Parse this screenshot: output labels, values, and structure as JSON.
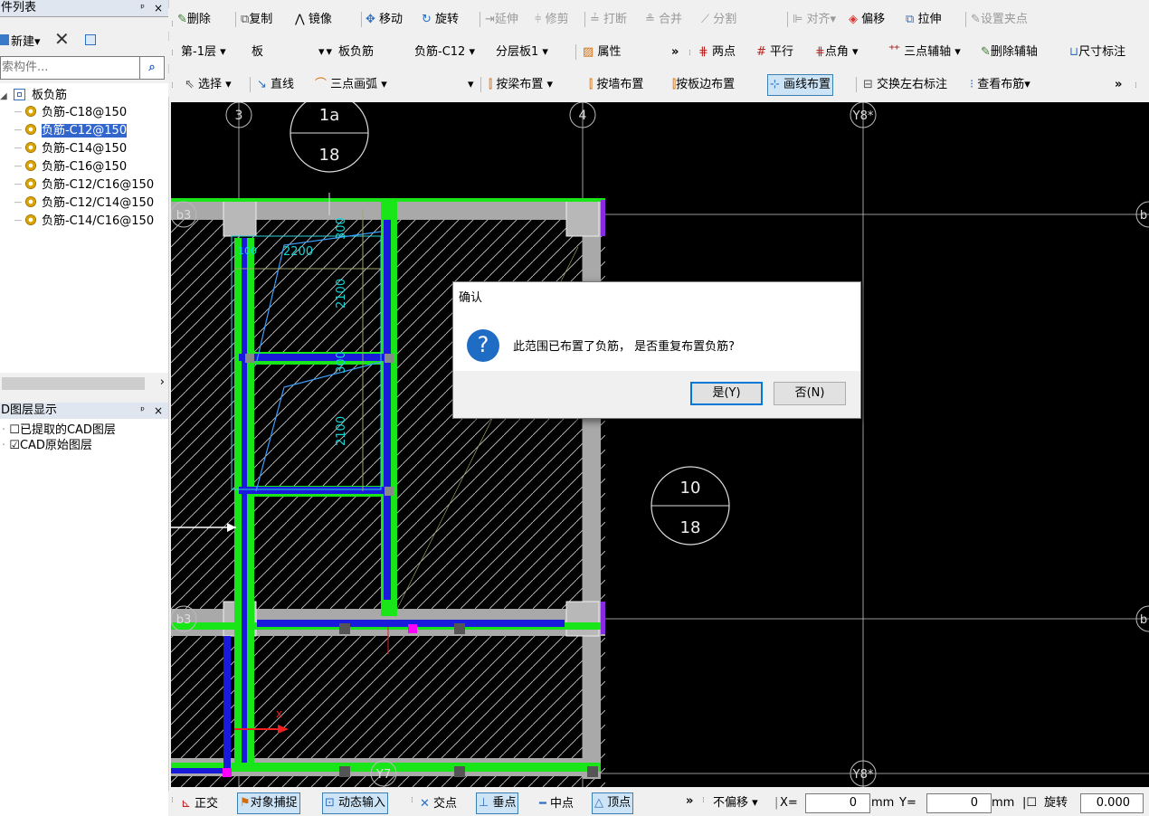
{
  "left_panel": {
    "component_title": "件列表",
    "new_label": "新建▾",
    "search_placeholder": "索构件...",
    "tree_root": "板负筋",
    "tree_items": [
      "负筋-C18@150",
      "负筋-C12@150",
      "负筋-C14@150",
      "负筋-C16@150",
      "负筋-C12/C16@150",
      "负筋-C12/C14@150",
      "负筋-C14/C16@150"
    ],
    "selected_index": 1,
    "layer_title": "D图层显示",
    "layers": [
      {
        "label": "已提取的CAD图层",
        "checked": false
      },
      {
        "label": "CAD原始图层",
        "checked": true
      }
    ],
    "pin": "ᵖ",
    "close": "×"
  },
  "toolbar1": [
    "删除",
    "复制",
    "镜像",
    "移动",
    "旋转",
    "延伸",
    "修剪",
    "打断",
    "合并",
    "分割",
    "对齐▾",
    "偏移",
    "拉伸",
    "设置夹点"
  ],
  "toolbar2": {
    "floor": "第-1层",
    "category": "板",
    "type": "板负筋",
    "component": "负筋-C12",
    "layer_board": "分层板1",
    "property": "属性",
    "more": "»",
    "axis_tools": [
      "两点",
      "平行",
      "点角 ▾",
      "三点辅轴 ▾",
      "删除辅轴",
      "尺寸标注"
    ]
  },
  "toolbar3": {
    "select": "选择 ▾",
    "line": "直线",
    "arc": "三点画弧 ▾",
    "by_beam": "按梁布置 ▾",
    "by_wall": "按墙布置",
    "by_edge": "按板边布置",
    "by_line": "画线布置",
    "swap": "交换左右标注",
    "view_rebar": "查看布筋▾",
    "more": "»"
  },
  "cad": {
    "axis_labels": [
      "3",
      "4",
      "Y8*",
      "b3",
      "b3",
      "Y8*",
      "Y7",
      "b",
      "b"
    ],
    "bubble_top": [
      "1a",
      "18"
    ],
    "bubble_right": [
      "10",
      "18"
    ],
    "dims": [
      "2200",
      "2100",
      "2100",
      "300",
      "300",
      "100"
    ]
  },
  "dialog": {
    "title": "确认",
    "icon": "?",
    "message": "此范围已布置了负筋， 是否重复布置负筋?",
    "yes": "是(Y)",
    "no": "否(N)"
  },
  "statusbar": {
    "ortho": "正交",
    "snap": "对象捕捉",
    "dynamic": "动态输入",
    "intersection": "交点",
    "perpendicular": "垂点",
    "midpoint": "中点",
    "vertex": "顶点",
    "more": "»",
    "offset": "不偏移",
    "x_label": "X=",
    "x_value": "0",
    "x_unit": "mm",
    "y_label": "Y=",
    "y_value": "0",
    "y_unit": "mm",
    "rotate": "旋转",
    "rotate_value": "0.000"
  }
}
